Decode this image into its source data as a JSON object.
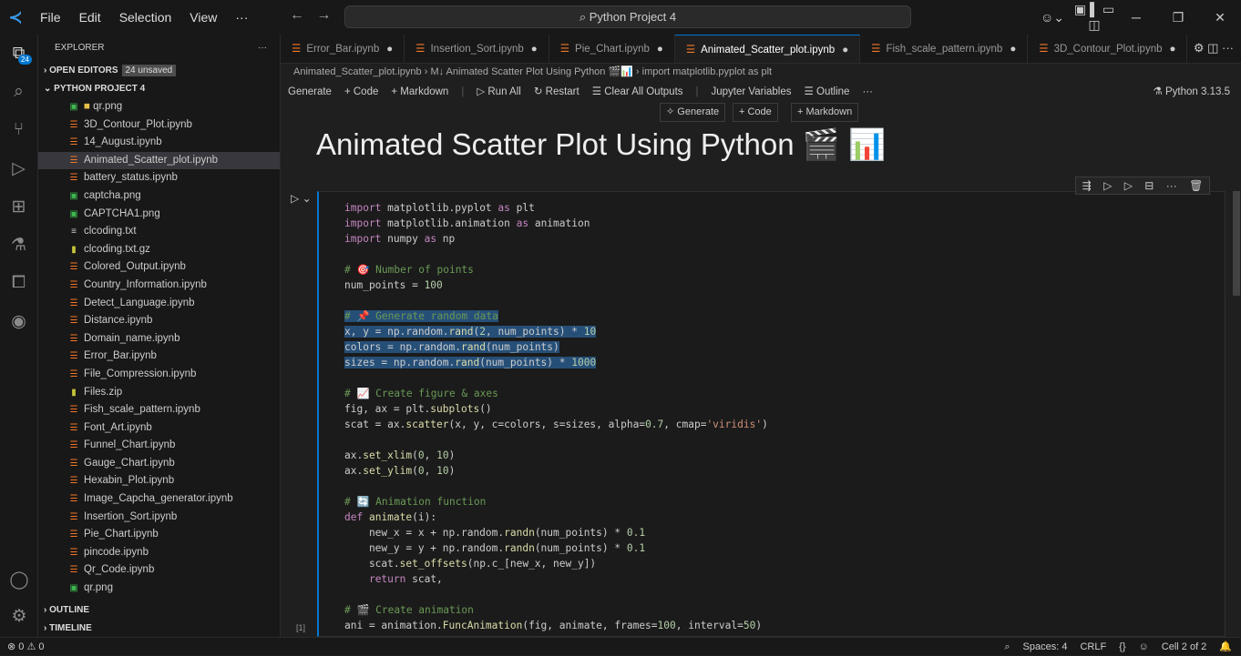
{
  "menu": [
    "File",
    "Edit",
    "Selection",
    "View",
    "···"
  ],
  "search": "Python Project 4",
  "explorer": {
    "title": "EXPLORER",
    "more": "···",
    "open_editors": "OPEN EDITORS",
    "unsaved": "24 unsaved",
    "project": "PYTHON PROJECT 4",
    "outline": "OUTLINE",
    "timeline": "TIMELINE",
    "files": [
      {
        "name": "qr.png",
        "type": "folder"
      },
      {
        "name": "3D_Contour_Plot.ipynb",
        "type": "nb"
      },
      {
        "name": "14_August.ipynb",
        "type": "nb"
      },
      {
        "name": "Animated_Scatter_plot.ipynb",
        "type": "nb",
        "selected": true
      },
      {
        "name": "battery_status.ipynb",
        "type": "nb"
      },
      {
        "name": "captcha.png",
        "type": "img"
      },
      {
        "name": "CAPTCHA1.png",
        "type": "img"
      },
      {
        "name": "clcoding.txt",
        "type": "txt"
      },
      {
        "name": "clcoding.txt.gz",
        "type": "zip"
      },
      {
        "name": "Colored_Output.ipynb",
        "type": "nb"
      },
      {
        "name": "Country_Information.ipynb",
        "type": "nb"
      },
      {
        "name": "Detect_Language.ipynb",
        "type": "nb"
      },
      {
        "name": "Distance.ipynb",
        "type": "nb"
      },
      {
        "name": "Domain_name.ipynb",
        "type": "nb"
      },
      {
        "name": "Error_Bar.ipynb",
        "type": "nb"
      },
      {
        "name": "File_Compression.ipynb",
        "type": "nb"
      },
      {
        "name": "Files.zip",
        "type": "zip"
      },
      {
        "name": "Fish_scale_pattern.ipynb",
        "type": "nb"
      },
      {
        "name": "Font_Art.ipynb",
        "type": "nb"
      },
      {
        "name": "Funnel_Chart.ipynb",
        "type": "nb"
      },
      {
        "name": "Gauge_Chart.ipynb",
        "type": "nb"
      },
      {
        "name": "Hexabin_Plot.ipynb",
        "type": "nb"
      },
      {
        "name": "Image_Capcha_generator.ipynb",
        "type": "nb"
      },
      {
        "name": "Insertion_Sort.ipynb",
        "type": "nb"
      },
      {
        "name": "Pie_Chart.ipynb",
        "type": "nb"
      },
      {
        "name": "pincode.ipynb",
        "type": "nb"
      },
      {
        "name": "Qr_Code.ipynb",
        "type": "nb"
      },
      {
        "name": "qr.png",
        "type": "img"
      }
    ]
  },
  "activity_badge": "24",
  "tabs": [
    {
      "label": "Error_Bar.ipynb"
    },
    {
      "label": "Insertion_Sort.ipynb"
    },
    {
      "label": "Pie_Chart.ipynb"
    },
    {
      "label": "Animated_Scatter_plot.ipynb",
      "active": true
    },
    {
      "label": "Fish_scale_pattern.ipynb"
    },
    {
      "label": "3D_Contour_Plot.ipynb"
    }
  ],
  "breadcrumb": [
    "Animated_Scatter_plot.ipynb",
    "M↓ Animated Scatter Plot Using Python 🎬📊",
    "import matplotlib.pyplot as plt"
  ],
  "toolbar": [
    "Generate",
    "+ Code",
    "+ Markdown",
    "|",
    "▷ Run All",
    "↻ Restart",
    "☰ Clear All Outputs",
    "|",
    "Jupyter Variables",
    "☰ Outline",
    "···"
  ],
  "kernel": "Python 3.13.5",
  "insert": {
    "generate": "Generate",
    "code": "+ Code",
    "markdown": "+ Markdown"
  },
  "heading": "Animated Scatter Plot Using Python 🎬 📊",
  "exec_count": "[1]",
  "code": [
    "import matplotlib.pyplot as plt",
    "import matplotlib.animation as animation",
    "import numpy as np",
    "",
    "# 🎯 Number of points",
    "num_points = 100",
    "",
    "# 📌 Generate random data",
    "x, y = np.random.rand(2, num_points) * 10",
    "colors = np.random.rand(num_points)",
    "sizes = np.random.rand(num_points) * 1000",
    "",
    "# 📈 Create figure & axes",
    "fig, ax = plt.subplots()",
    "scat = ax.scatter(x, y, c=colors, s=sizes, alpha=0.7, cmap='viridis')",
    "",
    "ax.set_xlim(0, 10)",
    "ax.set_ylim(0, 10)",
    "",
    "# 🔄 Animation function",
    "def animate(i):",
    "    new_x = x + np.random.randn(num_points) * 0.1",
    "    new_y = y + np.random.randn(num_points) * 0.1",
    "    scat.set_offsets(np.c_[new_x, new_y])",
    "    return scat,",
    "",
    "# 🎬 Create animation",
    "ani = animation.FuncAnimation(fig, animate, frames=100, interval=50)"
  ],
  "selected_lines": [
    7,
    8,
    9,
    10
  ],
  "status": {
    "left": "⊗ 0 ⚠ 0",
    "spaces": "Spaces: 4",
    "eol": "CRLF",
    "braces": "{}",
    "cell": "Cell 2 of 2"
  }
}
